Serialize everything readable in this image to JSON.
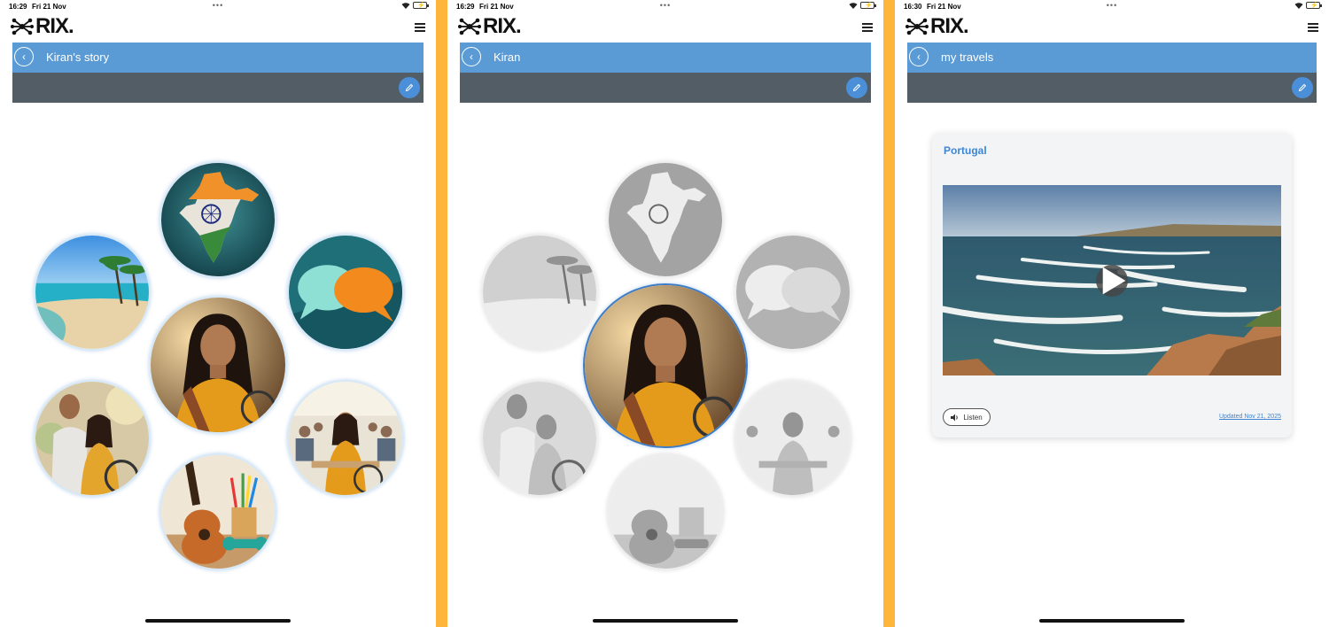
{
  "brand": {
    "logo_text": "RIX."
  },
  "colors": {
    "divider": "#ffb43c",
    "title_bar": "#5b9bd5",
    "toolbar": "#525d66",
    "accent": "#3e86d4"
  },
  "screens": [
    {
      "status": {
        "time": "16:29",
        "date": "Fri 21 Nov"
      },
      "title": "Kiran's story",
      "bubbles": [
        "india-map-bubble",
        "speech-bubbles-bubble",
        "beach-bubble",
        "kiran-portrait-bubble",
        "friends-bubble",
        "classroom-bubble",
        "guitar-bubble"
      ]
    },
    {
      "status": {
        "time": "16:29",
        "date": "Fri 21 Nov"
      },
      "title": "Kiran",
      "selected": "kiran-portrait-bubble"
    },
    {
      "status": {
        "time": "16:30",
        "date": "Fri 21 Nov"
      },
      "title": "my travels",
      "card": {
        "title": "Portugal",
        "listen_label": "Listen",
        "updated": "Updated Nov 21, 2025"
      }
    }
  ],
  "icons": [
    "back-icon",
    "edit-pencil-icon",
    "menu-icon",
    "wifi-icon",
    "battery-icon",
    "play-icon",
    "speaker-icon"
  ]
}
